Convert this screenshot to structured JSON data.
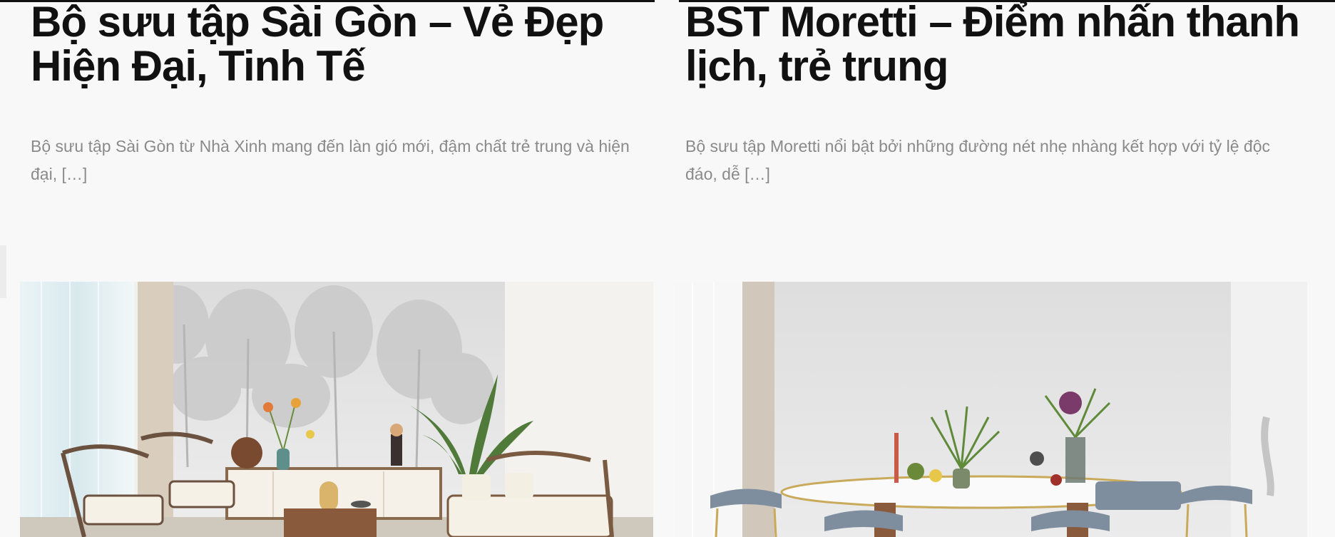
{
  "posts": [
    {
      "title": "Bộ sưu tập Sài Gòn – Vẻ Đẹp Hiện Đại, Tinh Tế",
      "excerpt": "Bộ sưu tập Sài Gòn từ Nhà Xinh mang đến làn gió mới, đậm chất trẻ trung và hiện đại, […]"
    },
    {
      "title": "BST Moretti – Điểm nhấn thanh lịch, trẻ trung",
      "excerpt": "Bộ sưu tập Moretti nổi bật bởi những đường nét nhẹ nhàng kết hợp với tỷ lệ độc đáo, dễ […]"
    }
  ],
  "colors": {
    "background": "#f8f8f8",
    "title": "#111111",
    "excerpt": "#8a8a8a",
    "top_rule": "#111111"
  }
}
